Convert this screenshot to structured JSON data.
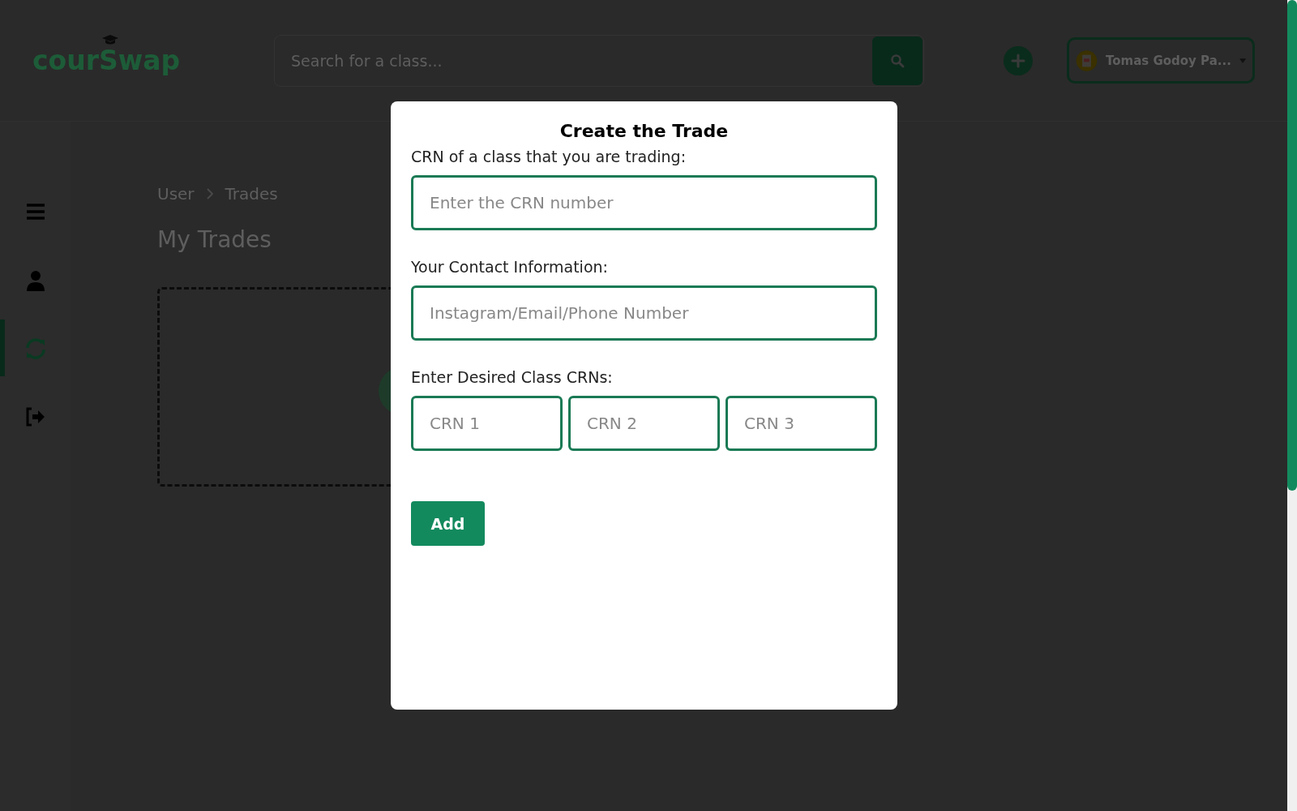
{
  "header": {
    "logo": "courSwap",
    "search": {
      "placeholder": "Search for a class..."
    },
    "user": {
      "name": "Tomas Godoy Pa..."
    }
  },
  "sidebar": {
    "items": [
      {
        "kind": "menu",
        "selected": false
      },
      {
        "kind": "user",
        "selected": false
      },
      {
        "kind": "trades",
        "selected": true
      },
      {
        "kind": "logout",
        "selected": false
      }
    ]
  },
  "breadcrumb": [
    "User",
    "Trades"
  ],
  "page_title": "My Trades",
  "modal": {
    "title": "Create the Trade",
    "fields": [
      {
        "label": "CRN of a class that you are trading:",
        "placeholder": "Enter the CRN number"
      },
      {
        "label": "Your Contact Information:",
        "placeholder": "Instagram/Email/Phone Number"
      }
    ],
    "desired_label": "Enter Desired Class CRNs:",
    "desired": [
      {
        "placeholder": "CRN 1"
      },
      {
        "placeholder": "CRN 2"
      },
      {
        "placeholder": "CRN 3"
      }
    ],
    "button": "Add"
  }
}
